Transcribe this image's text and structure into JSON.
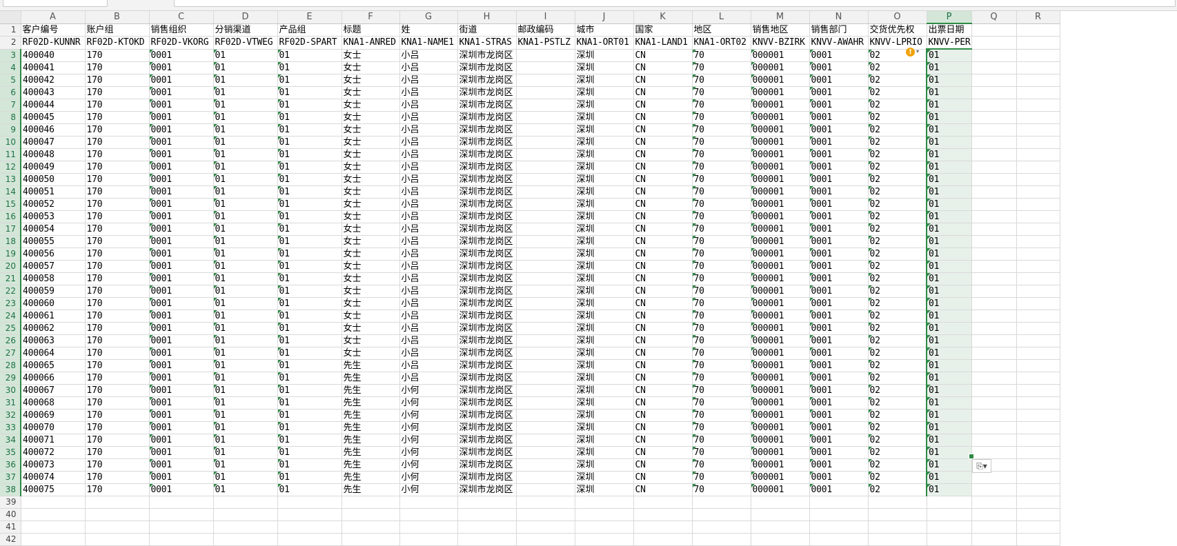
{
  "columns": [
    "A",
    "B",
    "C",
    "D",
    "E",
    "F",
    "G",
    "H",
    "I",
    "J",
    "K",
    "L",
    "M",
    "N",
    "O",
    "P",
    "Q",
    "R"
  ],
  "selected_column": "P",
  "header_row_1": [
    "客户编号",
    "账户组",
    "销售组织",
    "分销渠道",
    "产品组",
    "标题",
    "姓",
    "街道",
    "邮政编码",
    "城市",
    "国家",
    "地区",
    "销售地区",
    "销售部门",
    "交货优先权",
    "出票日期",
    "",
    ""
  ],
  "header_row_2": [
    "RF02D-KUNNR",
    "RF02D-KTOKD",
    "RF02D-VKORG",
    "RF02D-VTWEG",
    "RF02D-SPART",
    "KNA1-ANRED",
    "KNA1-NAME1",
    "KNA1-STRAS",
    "KNA1-PSTLZ",
    "KNA1-ORT01",
    "KNA1-LAND1",
    "KNA1-ORT02",
    "KNVV-BZIRK",
    "KNVV-AWAHR",
    "KNVV-LPRIO",
    "KNVV-PERFK",
    "",
    ""
  ],
  "data_rows": [
    [
      "400040",
      "170",
      "0001",
      "01",
      "01",
      "女士",
      "小吕",
      "深圳市龙岗区",
      "",
      "深圳",
      "CN",
      "70",
      "000001",
      "0001",
      "02",
      "01"
    ],
    [
      "400041",
      "170",
      "0001",
      "01",
      "01",
      "女士",
      "小吕",
      "深圳市龙岗区",
      "",
      "深圳",
      "CN",
      "70",
      "000001",
      "0001",
      "02",
      "01"
    ],
    [
      "400042",
      "170",
      "0001",
      "01",
      "01",
      "女士",
      "小吕",
      "深圳市龙岗区",
      "",
      "深圳",
      "CN",
      "70",
      "000001",
      "0001",
      "02",
      "01"
    ],
    [
      "400043",
      "170",
      "0001",
      "01",
      "01",
      "女士",
      "小吕",
      "深圳市龙岗区",
      "",
      "深圳",
      "CN",
      "70",
      "000001",
      "0001",
      "02",
      "01"
    ],
    [
      "400044",
      "170",
      "0001",
      "01",
      "01",
      "女士",
      "小吕",
      "深圳市龙岗区",
      "",
      "深圳",
      "CN",
      "70",
      "000001",
      "0001",
      "02",
      "01"
    ],
    [
      "400045",
      "170",
      "0001",
      "01",
      "01",
      "女士",
      "小吕",
      "深圳市龙岗区",
      "",
      "深圳",
      "CN",
      "70",
      "000001",
      "0001",
      "02",
      "01"
    ],
    [
      "400046",
      "170",
      "0001",
      "01",
      "01",
      "女士",
      "小吕",
      "深圳市龙岗区",
      "",
      "深圳",
      "CN",
      "70",
      "000001",
      "0001",
      "02",
      "01"
    ],
    [
      "400047",
      "170",
      "0001",
      "01",
      "01",
      "女士",
      "小吕",
      "深圳市龙岗区",
      "",
      "深圳",
      "CN",
      "70",
      "000001",
      "0001",
      "02",
      "01"
    ],
    [
      "400048",
      "170",
      "0001",
      "01",
      "01",
      "女士",
      "小吕",
      "深圳市龙岗区",
      "",
      "深圳",
      "CN",
      "70",
      "000001",
      "0001",
      "02",
      "01"
    ],
    [
      "400049",
      "170",
      "0001",
      "01",
      "01",
      "女士",
      "小吕",
      "深圳市龙岗区",
      "",
      "深圳",
      "CN",
      "70",
      "000001",
      "0001",
      "02",
      "01"
    ],
    [
      "400050",
      "170",
      "0001",
      "01",
      "01",
      "女士",
      "小吕",
      "深圳市龙岗区",
      "",
      "深圳",
      "CN",
      "70",
      "000001",
      "0001",
      "02",
      "01"
    ],
    [
      "400051",
      "170",
      "0001",
      "01",
      "01",
      "女士",
      "小吕",
      "深圳市龙岗区",
      "",
      "深圳",
      "CN",
      "70",
      "000001",
      "0001",
      "02",
      "01"
    ],
    [
      "400052",
      "170",
      "0001",
      "01",
      "01",
      "女士",
      "小吕",
      "深圳市龙岗区",
      "",
      "深圳",
      "CN",
      "70",
      "000001",
      "0001",
      "02",
      "01"
    ],
    [
      "400053",
      "170",
      "0001",
      "01",
      "01",
      "女士",
      "小吕",
      "深圳市龙岗区",
      "",
      "深圳",
      "CN",
      "70",
      "000001",
      "0001",
      "02",
      "01"
    ],
    [
      "400054",
      "170",
      "0001",
      "01",
      "01",
      "女士",
      "小吕",
      "深圳市龙岗区",
      "",
      "深圳",
      "CN",
      "70",
      "000001",
      "0001",
      "02",
      "01"
    ],
    [
      "400055",
      "170",
      "0001",
      "01",
      "01",
      "女士",
      "小吕",
      "深圳市龙岗区",
      "",
      "深圳",
      "CN",
      "70",
      "000001",
      "0001",
      "02",
      "01"
    ],
    [
      "400056",
      "170",
      "0001",
      "01",
      "01",
      "女士",
      "小吕",
      "深圳市龙岗区",
      "",
      "深圳",
      "CN",
      "70",
      "000001",
      "0001",
      "02",
      "01"
    ],
    [
      "400057",
      "170",
      "0001",
      "01",
      "01",
      "女士",
      "小吕",
      "深圳市龙岗区",
      "",
      "深圳",
      "CN",
      "70",
      "000001",
      "0001",
      "02",
      "01"
    ],
    [
      "400058",
      "170",
      "0001",
      "01",
      "01",
      "女士",
      "小吕",
      "深圳市龙岗区",
      "",
      "深圳",
      "CN",
      "70",
      "000001",
      "0001",
      "02",
      "01"
    ],
    [
      "400059",
      "170",
      "0001",
      "01",
      "01",
      "女士",
      "小吕",
      "深圳市龙岗区",
      "",
      "深圳",
      "CN",
      "70",
      "000001",
      "0001",
      "02",
      "01"
    ],
    [
      "400060",
      "170",
      "0001",
      "01",
      "01",
      "女士",
      "小吕",
      "深圳市龙岗区",
      "",
      "深圳",
      "CN",
      "70",
      "000001",
      "0001",
      "02",
      "01"
    ],
    [
      "400061",
      "170",
      "0001",
      "01",
      "01",
      "女士",
      "小吕",
      "深圳市龙岗区",
      "",
      "深圳",
      "CN",
      "70",
      "000001",
      "0001",
      "02",
      "01"
    ],
    [
      "400062",
      "170",
      "0001",
      "01",
      "01",
      "女士",
      "小吕",
      "深圳市龙岗区",
      "",
      "深圳",
      "CN",
      "70",
      "000001",
      "0001",
      "02",
      "01"
    ],
    [
      "400063",
      "170",
      "0001",
      "01",
      "01",
      "女士",
      "小吕",
      "深圳市龙岗区",
      "",
      "深圳",
      "CN",
      "70",
      "000001",
      "0001",
      "02",
      "01"
    ],
    [
      "400064",
      "170",
      "0001",
      "01",
      "01",
      "女士",
      "小吕",
      "深圳市龙岗区",
      "",
      "深圳",
      "CN",
      "70",
      "000001",
      "0001",
      "02",
      "01"
    ],
    [
      "400065",
      "170",
      "0001",
      "01",
      "01",
      "先生",
      "小吕",
      "深圳市龙岗区",
      "",
      "深圳",
      "CN",
      "70",
      "000001",
      "0001",
      "02",
      "01"
    ],
    [
      "400066",
      "170",
      "0001",
      "01",
      "01",
      "先生",
      "小吕",
      "深圳市龙岗区",
      "",
      "深圳",
      "CN",
      "70",
      "000001",
      "0001",
      "02",
      "01"
    ],
    [
      "400067",
      "170",
      "0001",
      "01",
      "01",
      "先生",
      "小何",
      "深圳市龙岗区",
      "",
      "深圳",
      "CN",
      "70",
      "000001",
      "0001",
      "02",
      "01"
    ],
    [
      "400068",
      "170",
      "0001",
      "01",
      "01",
      "先生",
      "小何",
      "深圳市龙岗区",
      "",
      "深圳",
      "CN",
      "70",
      "000001",
      "0001",
      "02",
      "01"
    ],
    [
      "400069",
      "170",
      "0001",
      "01",
      "01",
      "先生",
      "小何",
      "深圳市龙岗区",
      "",
      "深圳",
      "CN",
      "70",
      "000001",
      "0001",
      "02",
      "01"
    ],
    [
      "400070",
      "170",
      "0001",
      "01",
      "01",
      "先生",
      "小何",
      "深圳市龙岗区",
      "",
      "深圳",
      "CN",
      "70",
      "000001",
      "0001",
      "02",
      "01"
    ],
    [
      "400071",
      "170",
      "0001",
      "01",
      "01",
      "先生",
      "小何",
      "深圳市龙岗区",
      "",
      "深圳",
      "CN",
      "70",
      "000001",
      "0001",
      "02",
      "01"
    ],
    [
      "400072",
      "170",
      "0001",
      "01",
      "01",
      "先生",
      "小何",
      "深圳市龙岗区",
      "",
      "深圳",
      "CN",
      "70",
      "000001",
      "0001",
      "02",
      "01"
    ],
    [
      "400073",
      "170",
      "0001",
      "01",
      "01",
      "先生",
      "小何",
      "深圳市龙岗区",
      "",
      "深圳",
      "CN",
      "70",
      "000001",
      "0001",
      "02",
      "01"
    ],
    [
      "400074",
      "170",
      "0001",
      "01",
      "01",
      "先生",
      "小何",
      "深圳市龙岗区",
      "",
      "深圳",
      "CN",
      "70",
      "000001",
      "0001",
      "02",
      "01"
    ],
    [
      "400075",
      "170",
      "0001",
      "01",
      "01",
      "先生",
      "小何",
      "深圳市龙岗区",
      "",
      "深圳",
      "CN",
      "70",
      "000001",
      "0001",
      "02",
      "01"
    ]
  ],
  "empty_row_numbers": [
    "39",
    "40",
    "41",
    "42"
  ],
  "text_format_columns": [
    "C",
    "D",
    "E",
    "L",
    "M",
    "N",
    "O",
    "P"
  ],
  "warning_icon": {
    "glyph": "!",
    "dropdown_glyph": "▾",
    "color": "#f0a30a"
  },
  "quick_analysis_icon": "⎘▾",
  "colors": {
    "selection": "#2e8b46",
    "selection_fill": "#e8f0ea",
    "header_bg": "#f2f2f2"
  }
}
